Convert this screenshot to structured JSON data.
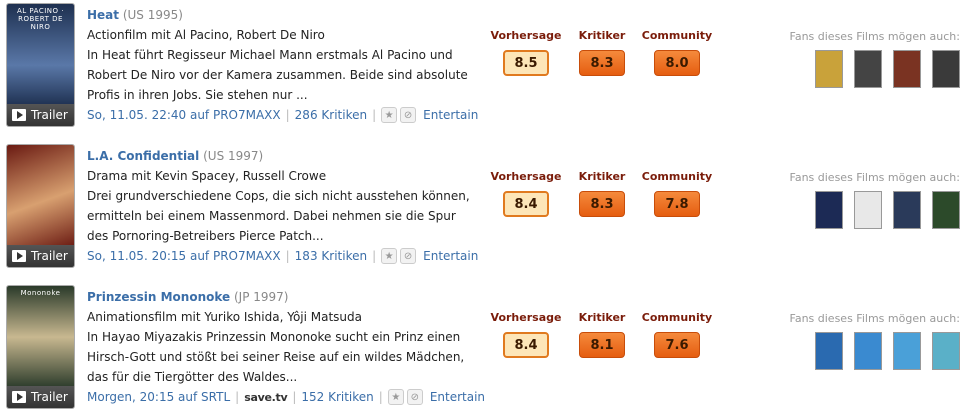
{
  "fans_label": "Fans dieses Films mögen auch:",
  "rating_labels": {
    "prediction": "Vorhersage",
    "critics": "Kritiker",
    "community": "Community"
  },
  "trailer_label": "Trailer",
  "colors": {
    "title_link": "#3b6ea8",
    "rating_label": "#7a1c0a",
    "badge_orange": "#e55d10",
    "prediction_bg": "#fde6b8"
  },
  "movies": [
    {
      "title": "Heat",
      "meta": "(US 1995)",
      "genre": "Actionfilm mit Al Pacino, Robert De Niro",
      "description": "In Heat führt Regisseur Michael Mann erstmals Al Pacino und Robert De Niro vor der Kamera zusammen. Beide sind absolute Profis in ihren Jobs. Sie stehen nur ...",
      "airing": "So, 11.05. 22:40 auf PRO7MAXX",
      "reviews": "286 Kritiken",
      "extra": "Entertain",
      "prediction": "8.5",
      "critics": "8.3",
      "community": "8.0",
      "poster_colors": [
        "#1e3050",
        "#5a78a8"
      ],
      "thumb_colors": [
        "#c9a23a",
        "#444444",
        "#7a3322",
        "#3a3a3a"
      ]
    },
    {
      "title": "L.A. Confidential",
      "meta": "(US 1997)",
      "genre": "Drama mit Kevin Spacey, Russell Crowe",
      "description": "Drei grundverschiedene Cops, die sich nicht ausstehen können, ermitteln bei einem Massenmord. Dabei nehmen sie die Spur des Pornoring-Betreibers Pierce Patch...",
      "airing": "So, 11.05. 20:15 auf PRO7MAXX",
      "reviews": "183 Kritiken",
      "extra": "Entertain",
      "prediction": "8.4",
      "critics": "8.3",
      "community": "7.8",
      "poster_colors": [
        "#6a1a12",
        "#d8a070"
      ],
      "thumb_colors": [
        "#1c2a55",
        "#e8e8e8",
        "#2a3a5a",
        "#2c4a2a"
      ]
    },
    {
      "title": "Prinzessin Mononoke",
      "meta": "(JP 1997)",
      "genre": "Animationsfilm mit Yuriko Ishida, Yôji Matsuda",
      "description": "In Hayao Miyazakis Prinzessin Mononoke sucht ein Prinz einen Hirsch-Gott und stößt bei seiner Reise auf ein wildes Mädchen, das für die Tiergötter des Waldes...",
      "airing": "Morgen, 20:15 auf SRTL",
      "provider": "save.tv",
      "reviews": "152 Kritiken",
      "extra": "Entertain",
      "prediction": "8.4",
      "critics": "8.1",
      "community": "7.6",
      "poster_colors": [
        "#2a3a2a",
        "#c8b890"
      ],
      "thumb_colors": [
        "#2a6ab0",
        "#3a8ad0",
        "#4aa0d8",
        "#5ab0c8"
      ]
    }
  ]
}
